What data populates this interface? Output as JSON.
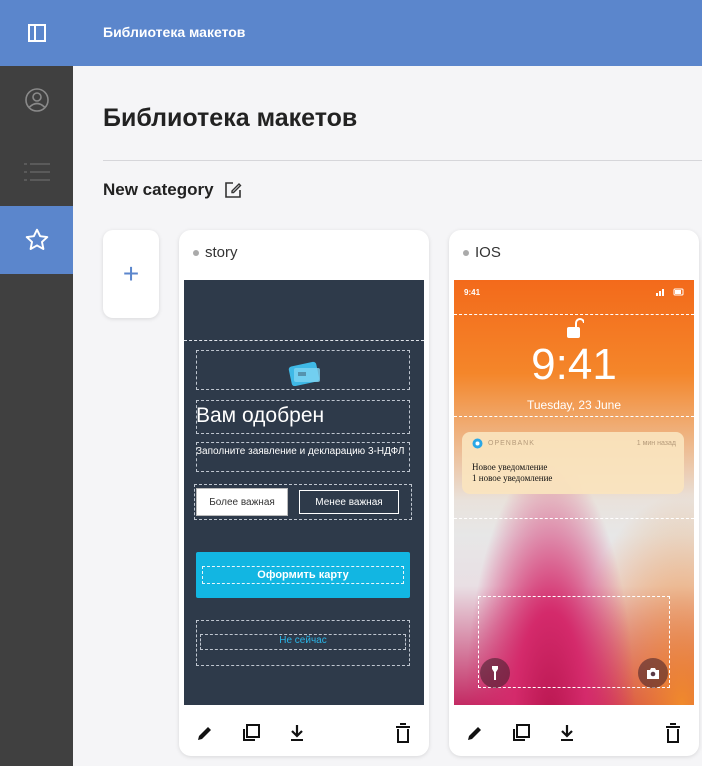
{
  "app": {
    "title": "Библиотека макетов"
  },
  "sidebar": {
    "items": [
      {
        "icon": "user-icon",
        "active": false
      },
      {
        "icon": "list-icon",
        "active": false
      },
      {
        "icon": "star-icon",
        "active": true
      }
    ]
  },
  "main": {
    "title": "Библиотека макетов",
    "category": {
      "name": "New category"
    },
    "add_label": "+"
  },
  "cards": [
    {
      "name": "story",
      "preview": {
        "heading": "Вам одобрен",
        "subtitle": "Заполните заявление и декларацию 3-НДФЛ",
        "option_a": "Более важная",
        "option_b": "Менее важная",
        "cta": "Оформить карту",
        "skip": "Не сейчас"
      }
    },
    {
      "name": "IOS",
      "preview": {
        "status_time": "9:41",
        "time": "9:41",
        "date": "Tuesday, 23 June",
        "notif_app": "OPENBANK",
        "notif_ago": "1 мин назад",
        "notif_title": "Новое уведомление",
        "notif_body": "1 новое уведомление"
      }
    }
  ],
  "colors": {
    "accent": "#5b86cc",
    "sidebar": "#404040",
    "cta": "#12b6e2"
  }
}
